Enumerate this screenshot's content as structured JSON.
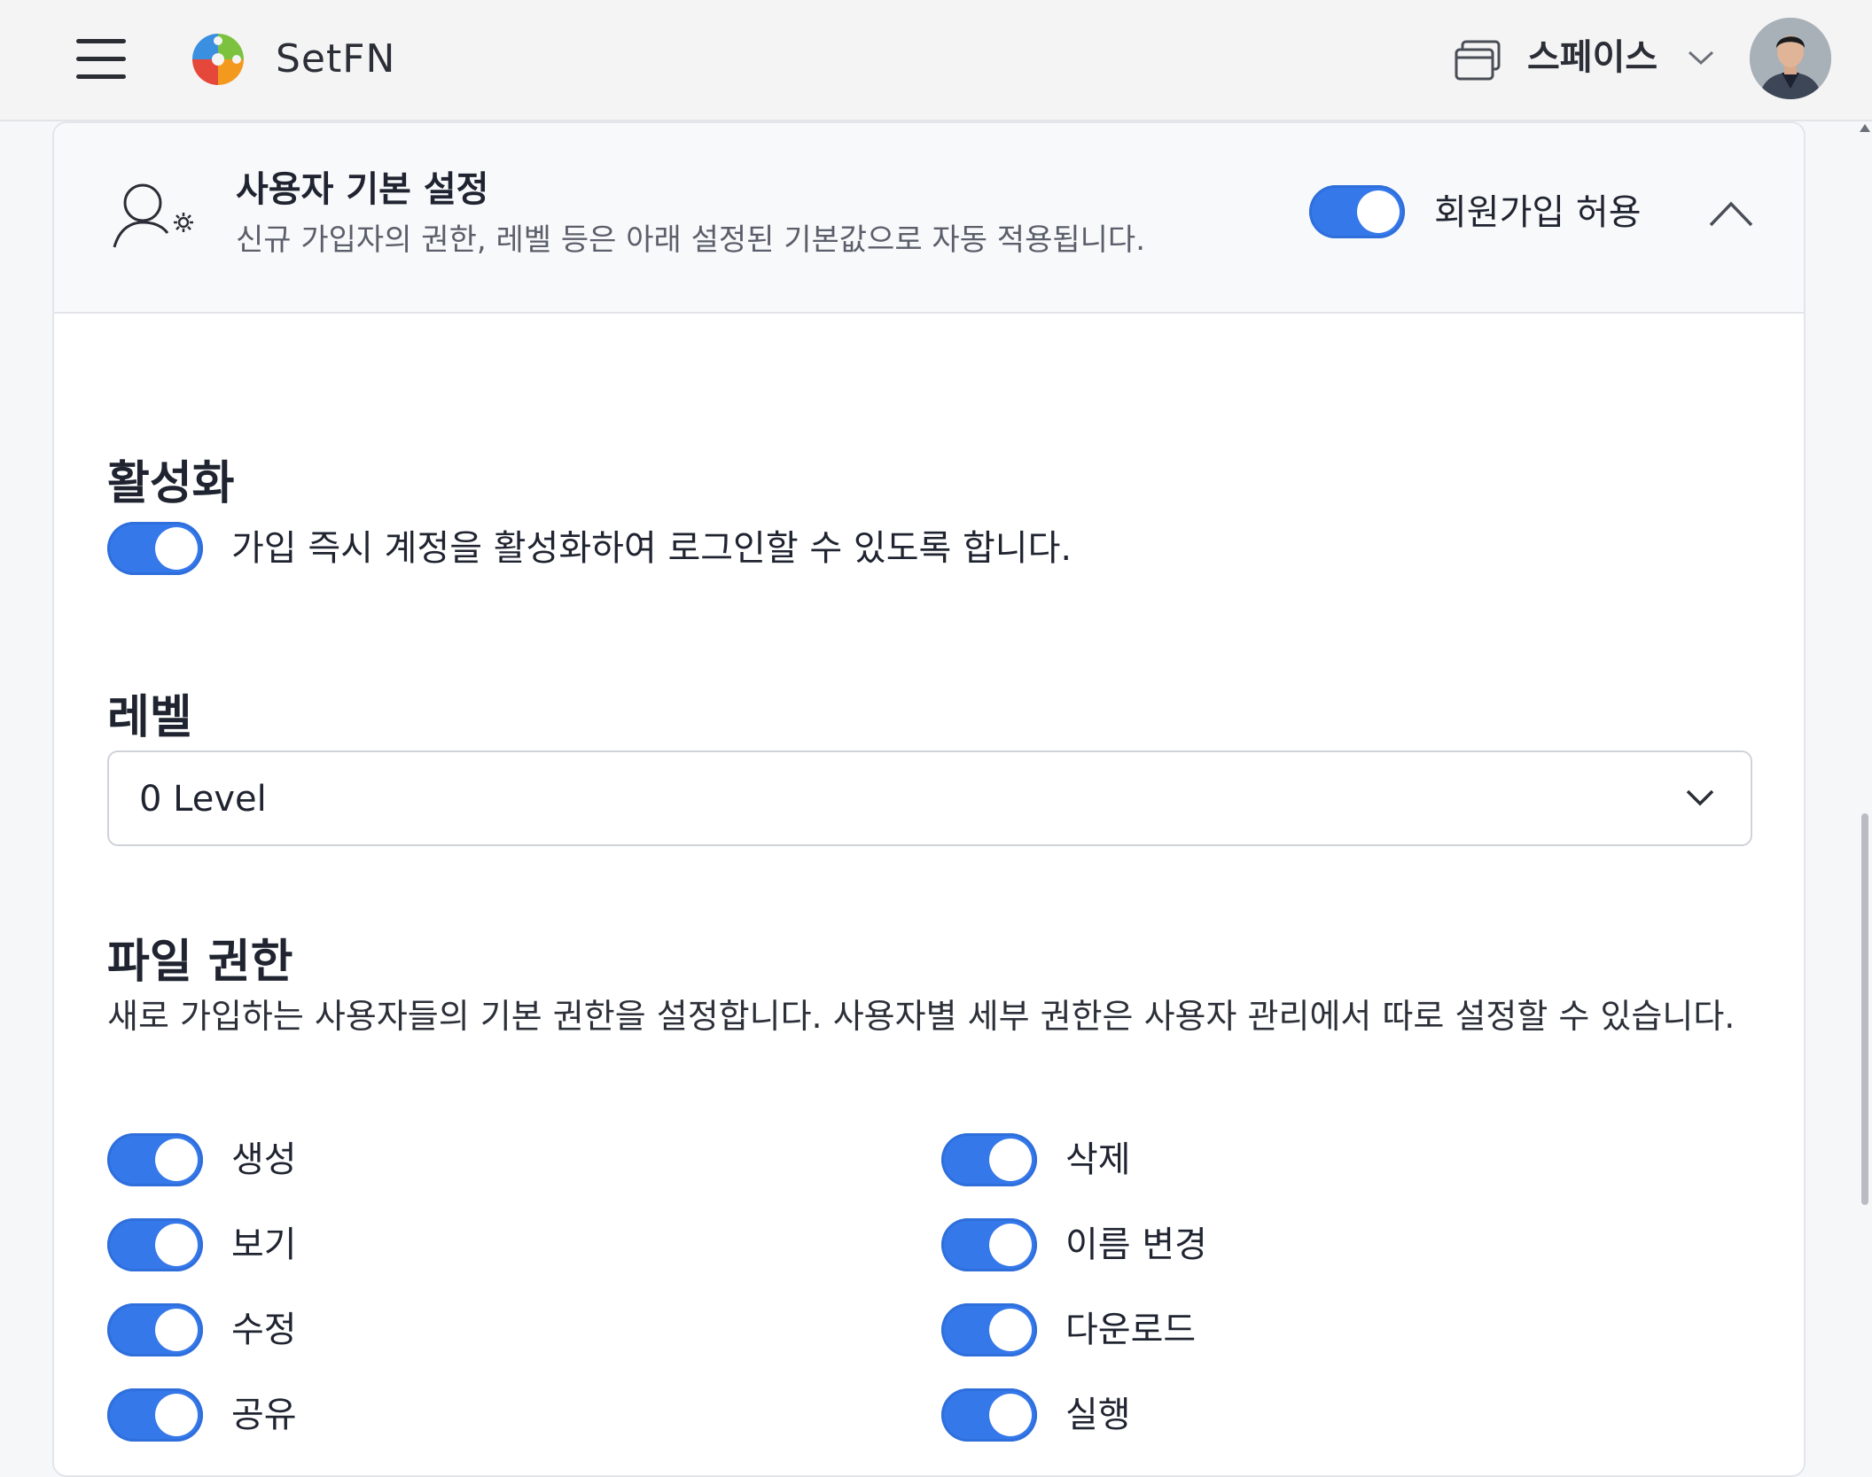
{
  "app": {
    "brand": "SetFN",
    "space_label": "스페이스"
  },
  "colors": {
    "accent": "#3578ea",
    "logo_blue": "#3a8fe0",
    "logo_green": "#7cc23f",
    "logo_orange": "#f39a1e",
    "logo_red": "#e5483b"
  },
  "icons": {
    "menu": "hamburger-icon",
    "logo": "puzzle-logo-icon",
    "space": "windows-stack-icon",
    "space_dropdown": "chevron-down-icon",
    "section": "user-gear-icon",
    "collapse": "chevron-up-icon",
    "select": "chevron-down-icon"
  },
  "card": {
    "title": "사용자 기본 설정",
    "subtitle": "신규 가입자의 권한, 레벨 등은 아래 설정된 기본값으로 자동 적용됩니다.",
    "signup_toggle_label": "회원가입 허용",
    "signup_enabled": true
  },
  "activation": {
    "title": "활성화",
    "description": "가입 즉시 계정을 활성화하여 로그인할 수 있도록 합니다.",
    "enabled": true
  },
  "level": {
    "title": "레벨",
    "selected": "0 Level"
  },
  "file_permissions": {
    "title": "파일 권한",
    "description": "새로 가입하는 사용자들의 기본 권한을 설정합니다. 사용자별 세부 권한은 사용자 관리에서 따로 설정할 수 있습니다.",
    "items": [
      {
        "label": "생성",
        "enabled": true
      },
      {
        "label": "삭제",
        "enabled": true
      },
      {
        "label": "보기",
        "enabled": true
      },
      {
        "label": "이름 변경",
        "enabled": true
      },
      {
        "label": "수정",
        "enabled": true
      },
      {
        "label": "다운로드",
        "enabled": true
      },
      {
        "label": "공유",
        "enabled": true
      },
      {
        "label": "실행",
        "enabled": true
      }
    ]
  }
}
